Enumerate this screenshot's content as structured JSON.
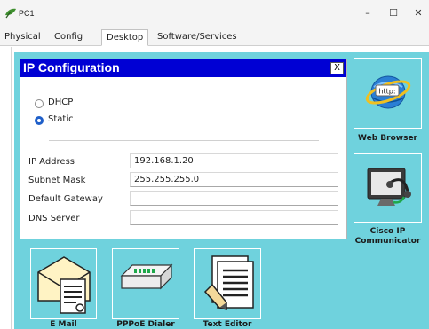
{
  "window": {
    "title": "PC1"
  },
  "tabs": [
    {
      "label": "Physical"
    },
    {
      "label": "Config"
    },
    {
      "label": "Desktop"
    },
    {
      "label": "Software/Services"
    }
  ],
  "desktop": {
    "apps": [
      {
        "label": "Web Browser",
        "icon": "web-browser-icon"
      },
      {
        "label": "Cisco IP\nCommunicator",
        "icon": "cisco-ip-communicator-icon"
      },
      {
        "label": "E Mail",
        "icon": "email-icon"
      },
      {
        "label": "PPPoE Dialer",
        "icon": "pppoe-dialer-icon"
      },
      {
        "label": "Text Editor",
        "icon": "text-editor-icon"
      }
    ]
  },
  "ip_config": {
    "title": "IP Configuration",
    "close_label": "X",
    "modes": [
      {
        "label": "DHCP",
        "selected": false
      },
      {
        "label": "Static",
        "selected": true
      }
    ],
    "fields": [
      {
        "label": "IP Address",
        "value": "192.168.1.20"
      },
      {
        "label": "Subnet Mask",
        "value": "255.255.255.0"
      },
      {
        "label": "Default Gateway",
        "value": ""
      },
      {
        "label": "DNS Server",
        "value": ""
      }
    ]
  },
  "colors": {
    "desktop": "#6fd2dd",
    "dialog_title": "#0000d4",
    "radio_selected": "#1f5fc9"
  }
}
